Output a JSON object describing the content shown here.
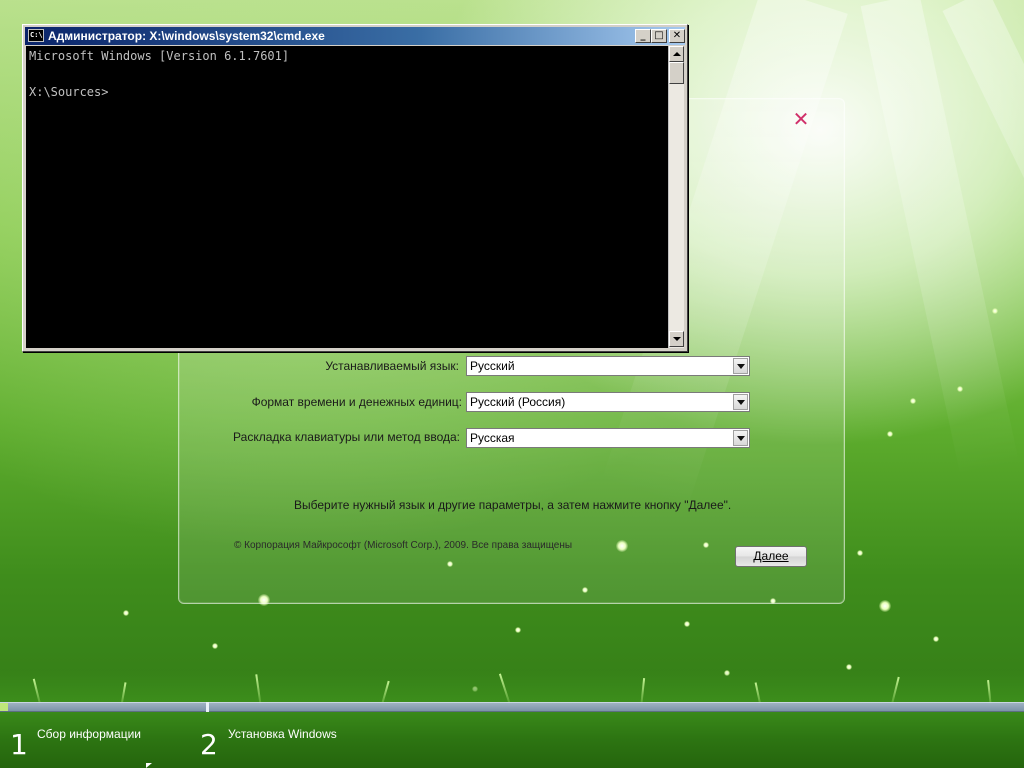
{
  "cmd": {
    "title": "Администратор: X:\\windows\\system32\\cmd.exe",
    "icon": "cmd-icon",
    "icon_glyph": "C:\\",
    "minimize_glyph": "_",
    "maximize_glyph": "□",
    "close_glyph": "✕",
    "lines": [
      "Microsoft Windows [Version 6.1.7601]",
      "",
      "X:\\Sources>"
    ]
  },
  "setup": {
    "close_icon": "close-icon",
    "close_glyph": "✕",
    "accent_close_color": "#d0306a",
    "language_label": "Устанавливаемый язык:",
    "language_value": "Русский",
    "format_label": "Формат времени и денежных единиц:",
    "format_value": "Русский (Россия)",
    "keyboard_label": "Раскладка клавиатуры или метод ввода:",
    "keyboard_value": "Русская",
    "instruction": "Выберите нужный язык и другие параметры, а затем нажмите кнопку \"Далее\".",
    "copyright": "© Корпорация Майкрософт (Microsoft Corp.), 2009. Все права защищены",
    "next_label": "Далее"
  },
  "progress": {
    "steps": [
      {
        "number": "1",
        "label": "Сбор информации"
      },
      {
        "number": "2",
        "label": "Установка Windows"
      }
    ]
  }
}
